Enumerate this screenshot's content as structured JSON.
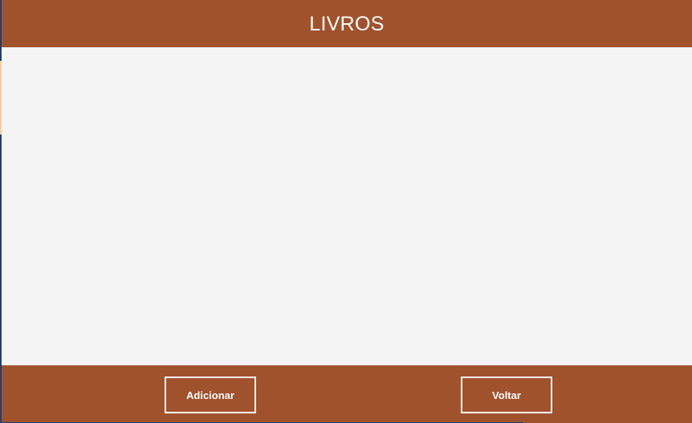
{
  "header": {
    "title": "LIVROS"
  },
  "footer": {
    "add_label": "Adicionar",
    "back_label": "Voltar"
  },
  "colors": {
    "bar": "#a0522d",
    "content_bg": "#f4f4f4",
    "button_text": "#ffffff"
  }
}
